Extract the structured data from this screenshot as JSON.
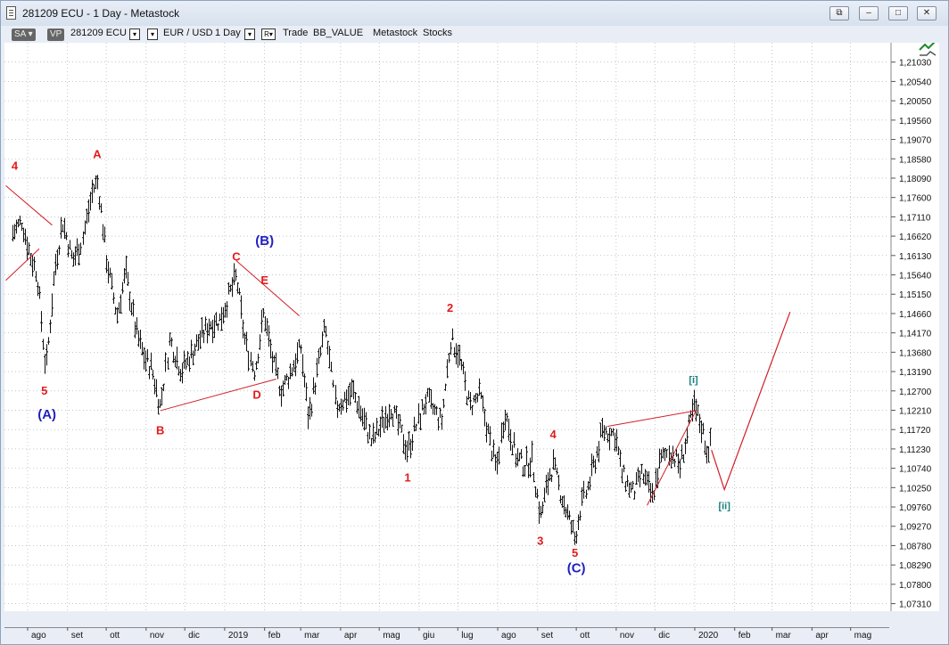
{
  "window": {
    "title": "281209 ECU - 1 Day - Metastock",
    "buttons": [
      "restore-tile",
      "minimize",
      "maximize",
      "close"
    ]
  },
  "toolbar": {
    "sa_label": "SA",
    "vp_label": "VP",
    "symbol": "281209 ECU",
    "pair": "EUR / USD",
    "period": "1 Day",
    "r_label": "R",
    "items": [
      "Trade",
      "BB_VALUE",
      "Metastock",
      "Stocks"
    ]
  },
  "chart_data": {
    "type": "ohlc",
    "instrument": "EUR / USD",
    "yticks": [
      "1,21030",
      "1,20540",
      "1,20050",
      "1,19560",
      "1,19070",
      "1,18580",
      "1,18090",
      "1,17600",
      "1,17110",
      "1,16620",
      "1,16130",
      "1,15640",
      "1,15150",
      "1,14660",
      "1,14170",
      "1,13680",
      "1,13190",
      "1,12700",
      "1,12210",
      "1,11720",
      "1,11230",
      "1,10740",
      "1,10250",
      "1,09760",
      "1,09270",
      "1,08780",
      "1,08290",
      "1,07800",
      "1,07310"
    ],
    "xticks": [
      "ago",
      "set",
      "ott",
      "nov",
      "dic",
      "2019",
      "feb",
      "mar",
      "apr",
      "mag",
      "giu",
      "lug",
      "ago",
      "set",
      "ott",
      "nov",
      "dic",
      "2020",
      "feb",
      "mar",
      "apr",
      "mag"
    ],
    "ylim": [
      1.0712,
      1.2152
    ],
    "price_path": [
      [
        "2018-07-20",
        1.167
      ],
      [
        "2018-07-27",
        1.17
      ],
      [
        "2018-08-03",
        1.161
      ],
      [
        "2018-08-08",
        1.157
      ],
      [
        "2018-08-15",
        1.132
      ],
      [
        "2018-08-22",
        1.158
      ],
      [
        "2018-08-28",
        1.17
      ],
      [
        "2018-09-05",
        1.16
      ],
      [
        "2018-09-12",
        1.165
      ],
      [
        "2018-09-20",
        1.178
      ],
      [
        "2018-09-24",
        1.18
      ],
      [
        "2018-10-01",
        1.16
      ],
      [
        "2018-10-09",
        1.146
      ],
      [
        "2018-10-16",
        1.157
      ],
      [
        "2018-10-24",
        1.142
      ],
      [
        "2018-10-31",
        1.135
      ],
      [
        "2018-11-05",
        1.133
      ],
      [
        "2018-11-12",
        1.123
      ],
      [
        "2018-11-19",
        1.14
      ],
      [
        "2018-11-28",
        1.132
      ],
      [
        "2018-12-05",
        1.136
      ],
      [
        "2018-12-12",
        1.14
      ],
      [
        "2018-12-20",
        1.144
      ],
      [
        "2018-12-28",
        1.145
      ],
      [
        "2019-01-10",
        1.156
      ],
      [
        "2019-01-17",
        1.139
      ],
      [
        "2019-01-24",
        1.132
      ],
      [
        "2019-01-31",
        1.147
      ],
      [
        "2019-02-07",
        1.134
      ],
      [
        "2019-02-14",
        1.127
      ],
      [
        "2019-02-21",
        1.132
      ],
      [
        "2019-03-01",
        1.138
      ],
      [
        "2019-03-07",
        1.12
      ],
      [
        "2019-03-20",
        1.143
      ],
      [
        "2019-03-28",
        1.123
      ],
      [
        "2019-04-10",
        1.127
      ],
      [
        "2019-04-25",
        1.114
      ],
      [
        "2019-05-10",
        1.123
      ],
      [
        "2019-05-23",
        1.112
      ],
      [
        "2019-06-06",
        1.125
      ],
      [
        "2019-06-18",
        1.119
      ],
      [
        "2019-06-25",
        1.14
      ],
      [
        "2019-07-01",
        1.137
      ],
      [
        "2019-07-10",
        1.123
      ],
      [
        "2019-07-18",
        1.126
      ],
      [
        "2019-07-31",
        1.107
      ],
      [
        "2019-08-06",
        1.122
      ],
      [
        "2019-08-15",
        1.11
      ],
      [
        "2019-08-22",
        1.108
      ],
      [
        "2019-08-27",
        1.11
      ],
      [
        "2019-09-03",
        1.095
      ],
      [
        "2019-09-10",
        1.106
      ],
      [
        "2019-09-13",
        1.108
      ],
      [
        "2019-09-19",
        1.101
      ],
      [
        "2019-09-30",
        1.0895
      ],
      [
        "2019-10-04",
        1.097
      ],
      [
        "2019-10-10",
        1.103
      ],
      [
        "2019-10-21",
        1.117
      ],
      [
        "2019-10-31",
        1.116
      ],
      [
        "2019-11-05",
        1.106
      ],
      [
        "2019-11-14",
        1.101
      ],
      [
        "2019-11-21",
        1.106
      ],
      [
        "2019-11-29",
        1.1
      ],
      [
        "2019-12-05",
        1.109
      ],
      [
        "2019-12-12",
        1.112
      ],
      [
        "2019-12-20",
        1.108
      ],
      [
        "2019-12-26",
        1.116
      ],
      [
        "2019-12-31",
        1.123
      ],
      [
        "2020-01-06",
        1.118
      ],
      [
        "2020-01-10",
        1.112
      ],
      [
        "2020-01-14",
        1.114
      ]
    ],
    "annotations": [
      {
        "label": "4",
        "color": "#e41a1c",
        "x": "2018-07-22",
        "y": 1.183
      },
      {
        "label": "A",
        "color": "#e41a1c",
        "x": "2018-09-24",
        "y": 1.186
      },
      {
        "label": "5",
        "color": "#e41a1c",
        "x": "2018-08-14",
        "y": 1.126
      },
      {
        "label": "(A)",
        "color": "#1f1fbf",
        "x": "2018-08-16",
        "y": 1.12
      },
      {
        "label": "B",
        "color": "#e41a1c",
        "x": "2018-11-12",
        "y": 1.116
      },
      {
        "label": "C",
        "color": "#e41a1c",
        "x": "2019-01-10",
        "y": 1.16
      },
      {
        "label": "(B)",
        "color": "#1f1fbf",
        "x": "2019-02-01",
        "y": 1.164
      },
      {
        "label": "E",
        "color": "#e41a1c",
        "x": "2019-02-01",
        "y": 1.154
      },
      {
        "label": "D",
        "color": "#e41a1c",
        "x": "2019-01-26",
        "y": 1.125
      },
      {
        "label": "1",
        "color": "#e41a1c",
        "x": "2019-05-23",
        "y": 1.104
      },
      {
        "label": "2",
        "color": "#e41a1c",
        "x": "2019-06-25",
        "y": 1.147
      },
      {
        "label": "3",
        "color": "#e41a1c",
        "x": "2019-09-03",
        "y": 1.088
      },
      {
        "label": "4",
        "color": "#e41a1c",
        "x": "2019-09-13",
        "y": 1.115
      },
      {
        "label": "5",
        "color": "#e41a1c",
        "x": "2019-09-30",
        "y": 1.085
      },
      {
        "label": "(C)",
        "color": "#1f1fbf",
        "x": "2019-10-01",
        "y": 1.081
      },
      {
        "label": "[i]",
        "color": "#1a8080",
        "x": "2019-12-31",
        "y": 1.129
      },
      {
        "label": "[ii]",
        "color": "#1a8080",
        "x": "2020-01-24",
        "y": 1.097
      }
    ],
    "trendlines": [
      {
        "from": [
          "2018-07-15",
          1.179
        ],
        "to": [
          "2018-08-20",
          1.169
        ]
      },
      {
        "from": [
          "2018-07-15",
          1.155
        ],
        "to": [
          "2018-08-10",
          1.163
        ]
      },
      {
        "from": [
          "2018-11-12",
          1.122
        ],
        "to": [
          "2019-02-10",
          1.13
        ]
      },
      {
        "from": [
          "2019-01-10",
          1.16
        ],
        "to": [
          "2019-02-28",
          1.146
        ]
      },
      {
        "from": [
          "2019-10-25",
          1.118
        ],
        "to": [
          "2020-01-02",
          1.122
        ]
      },
      {
        "from": [
          "2019-11-25",
          1.098
        ],
        "to": [
          "2020-01-02",
          1.122
        ]
      }
    ],
    "projection": [
      [
        "2020-01-14",
        1.112
      ],
      [
        "2020-01-24",
        1.102
      ],
      [
        "2020-03-15",
        1.147
      ]
    ]
  }
}
